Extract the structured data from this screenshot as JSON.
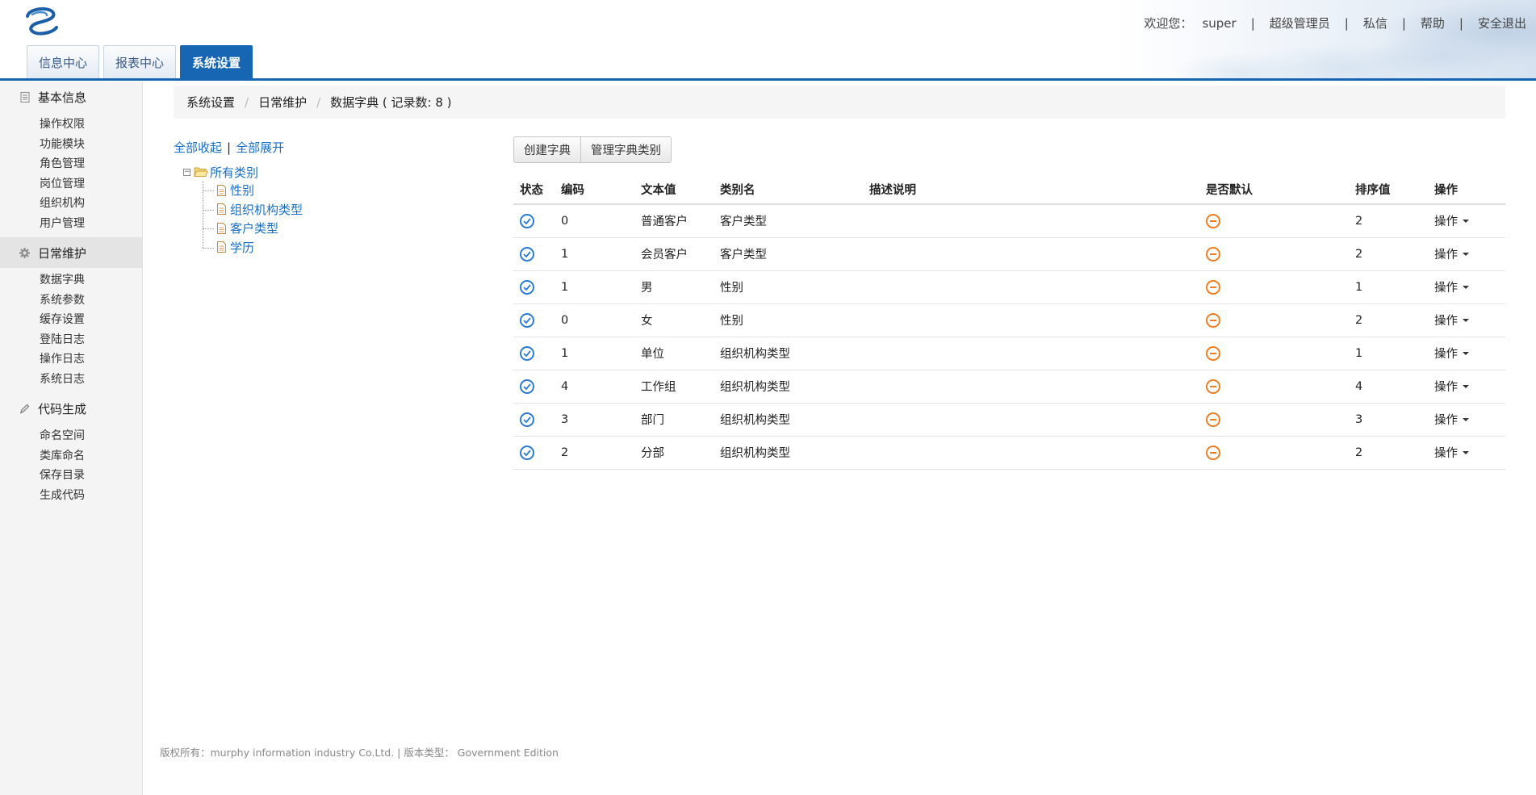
{
  "header": {
    "welcome_label": "欢迎您：",
    "username": "super",
    "links": [
      "超级管理员",
      "私信",
      "帮助",
      "安全退出"
    ],
    "tabs": [
      {
        "label": "信息中心",
        "active": false
      },
      {
        "label": "报表中心",
        "active": false
      },
      {
        "label": "系统设置",
        "active": true
      }
    ],
    "accent_color": "#1766b3"
  },
  "sidebar": {
    "groups": [
      {
        "title": "基本信息",
        "icon": "document-icon",
        "active": false,
        "items": [
          "操作权限",
          "功能模块",
          "角色管理",
          "岗位管理",
          "组织机构",
          "用户管理"
        ]
      },
      {
        "title": "日常维护",
        "icon": "gear-icon",
        "active": true,
        "items": [
          "数据字典",
          "系统参数",
          "缓存设置",
          "登陆日志",
          "操作日志",
          "系统日志"
        ]
      },
      {
        "title": "代码生成",
        "icon": "pencil-icon",
        "active": false,
        "items": [
          "命名空间",
          "类库命名",
          "保存目录",
          "生成代码"
        ]
      }
    ]
  },
  "breadcrumb": {
    "items": [
      "系统设置",
      "日常维护",
      "数据字典 ( 记录数: 8 )"
    ]
  },
  "tree": {
    "collapse_all": "全部收起",
    "expand_all": "全部展开",
    "separator": "|",
    "root": "所有类别",
    "children": [
      "性别",
      "组织机构类型",
      "客户类型",
      "学历"
    ]
  },
  "toolbar": {
    "create_label": "创建字典",
    "manage_label": "管理字典类别"
  },
  "table": {
    "headers": [
      "状态",
      "编码",
      "文本值",
      "类别名",
      "描述说明",
      "是否默认",
      "排序值",
      "操作"
    ],
    "op_label": "操作",
    "rows": [
      {
        "code": "0",
        "text": "普通客户",
        "category": "客户类型",
        "desc": "",
        "sort": "2"
      },
      {
        "code": "1",
        "text": "会员客户",
        "category": "客户类型",
        "desc": "",
        "sort": "2"
      },
      {
        "code": "1",
        "text": "男",
        "category": "性别",
        "desc": "",
        "sort": "1"
      },
      {
        "code": "0",
        "text": "女",
        "category": "性别",
        "desc": "",
        "sort": "2"
      },
      {
        "code": "1",
        "text": "单位",
        "category": "组织机构类型",
        "desc": "",
        "sort": "1"
      },
      {
        "code": "4",
        "text": "工作组",
        "category": "组织机构类型",
        "desc": "",
        "sort": "4"
      },
      {
        "code": "3",
        "text": "部门",
        "category": "组织机构类型",
        "desc": "",
        "sort": "3"
      },
      {
        "code": "2",
        "text": "分部",
        "category": "组织机构类型",
        "desc": "",
        "sort": "2"
      }
    ],
    "status_color": "#2a7bd6",
    "default_color": "#f07d22"
  },
  "footer": {
    "text": "版权所有：murphy information industry Co.Ltd. | 版本类型： Government Edition"
  }
}
